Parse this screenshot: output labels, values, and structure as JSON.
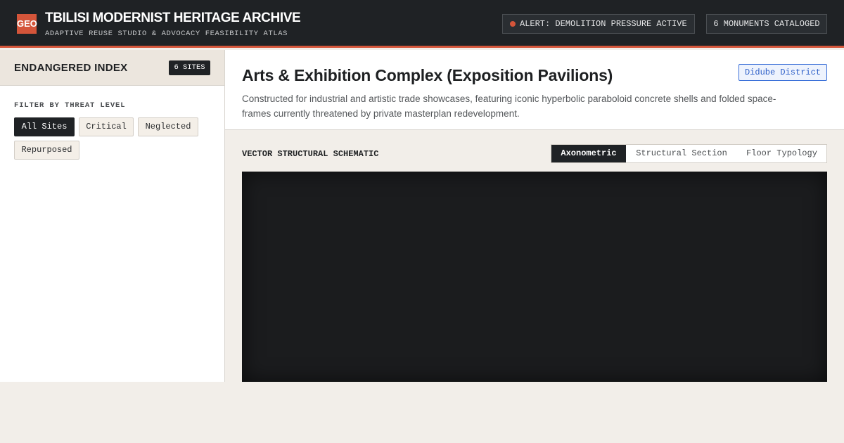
{
  "header": {
    "logo_text": "GEO",
    "title": "TBILISI MODERNIST HERITAGE ARCHIVE",
    "subtitle": "ADAPTIVE REUSE STUDIO & ADVOCACY FEASIBILITY ATLAS",
    "alert": "ALERT: DEMOLITION PRESSURE ACTIVE",
    "count": "6 MONUMENTS CATALOGED"
  },
  "sidebar": {
    "title": "ENDANGERED INDEX",
    "sites_badge": "6 SITES",
    "filter_label": "FILTER BY THREAT LEVEL",
    "filters": [
      {
        "label": "All Sites",
        "active": true
      },
      {
        "label": "Critical",
        "active": false
      },
      {
        "label": "Neglected",
        "active": false
      },
      {
        "label": "Repurposed",
        "active": false
      }
    ]
  },
  "site": {
    "title": "Arts & Exhibition Complex (Exposition Pavilions)",
    "district": "Didube District",
    "description": "Constructed for industrial and artistic trade showcases, featuring iconic hyperbolic paraboloid concrete shells and folded space-frames currently threatened by private masterplan redevelopment."
  },
  "schematic": {
    "label": "VECTOR STRUCTURAL SCHEMATIC",
    "tabs": [
      {
        "label": "Axonometric",
        "active": true
      },
      {
        "label": "Structural Section",
        "active": false
      },
      {
        "label": "Floor Typology",
        "active": false
      }
    ]
  },
  "colors": {
    "accent": "#d4553a",
    "dark": "#1f2225",
    "district_blue": "#2d5fc8"
  }
}
